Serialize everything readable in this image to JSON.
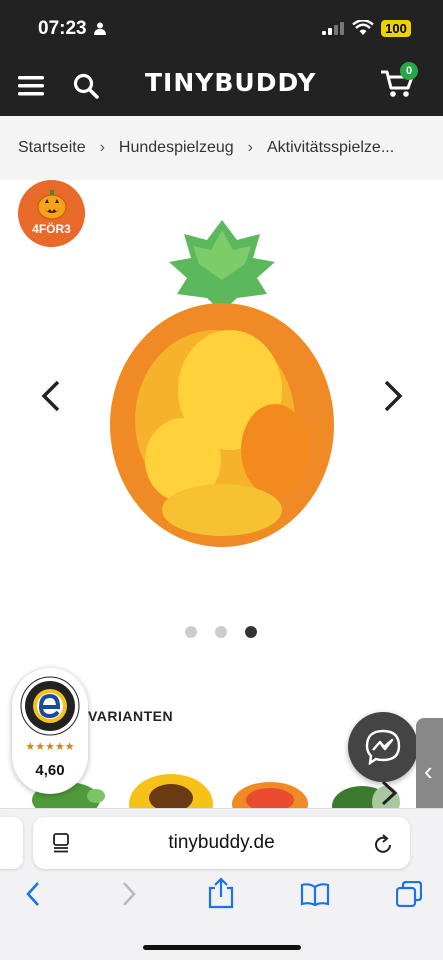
{
  "status_bar": {
    "time": "07:23",
    "battery": "100"
  },
  "header": {
    "logo": "TINYBUDDY",
    "cart_count": "0"
  },
  "breadcrumb": {
    "items": [
      "Startseite",
      "Hundespielzeug",
      "Aktivitätsspielze..."
    ],
    "separator": "›"
  },
  "promo_badge": {
    "label": "4FÖR3"
  },
  "gallery": {
    "image_count": 3,
    "active_index": 2
  },
  "variants": {
    "title": "VARIANTEN"
  },
  "trusted_shops": {
    "rating": "4,60",
    "stars": "★★★★★"
  },
  "browser": {
    "url": "tinybuddy.de"
  },
  "colors": {
    "brand_dark": "#222222",
    "cart_badge": "#27a745",
    "promo": "#e8692a",
    "browser_blue": "#1a73e8"
  }
}
